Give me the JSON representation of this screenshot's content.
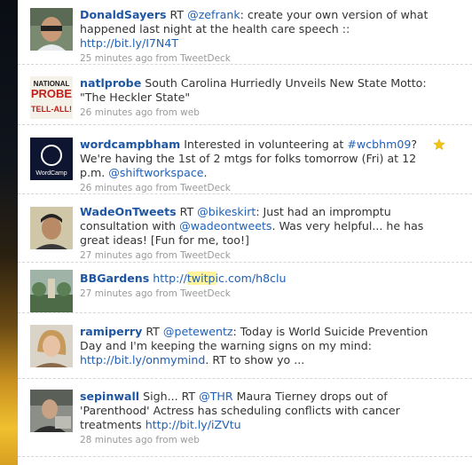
{
  "colors": {
    "author": "#1f56a3",
    "link": "#2061b8",
    "meta": "#9a9a9a",
    "highlight": "#fff49c",
    "star": "#f1c40f"
  },
  "tweets": [
    {
      "author": "DonaldSayers",
      "text_before": " RT ",
      "mention": "@zefrank",
      "text_after": ": create your own version of what happened last night at the health care speech :: ",
      "link": "http://bit.ly/I7N4T",
      "time": "25 minutes ago",
      "via": "from TweetDeck",
      "avatar_icon": "person-avatar-icon"
    },
    {
      "author": "natlprobe",
      "text": " South Carolina Hurriedly Unveils New State Motto: \"The Heckler State\"",
      "time": "26 minutes ago",
      "via": "from web",
      "avatar_logo_top": "NATIONAL",
      "avatar_logo_mid": "PROBE",
      "avatar_logo_bot": "TELL-ALL!"
    },
    {
      "author": "wordcampbham",
      "text_before": " Interested in volunteering at ",
      "hashtag": "#wcbhm09",
      "text_mid": "? We're having the 1st of 2 mtgs for folks tomorrow (Fri) at 12 p.m. ",
      "mention": "@shiftworkspace",
      "text_after": ".",
      "time": "26 minutes ago",
      "via": "from TweetDeck",
      "avatar_logo": "WordCamp",
      "favorited": true
    },
    {
      "author": "WadeOnTweets",
      "text_before": " RT ",
      "mention": "@bikeskirt",
      "text_mid": ": Just had an impromptu consultation with ",
      "mention2": "@wadeontweets",
      "text_after": ". Was very helpful... he has great ideas! [Fun for me, too!]",
      "time": "27 minutes ago",
      "via": "from TweetDeck"
    },
    {
      "author": "BBGardens",
      "link_before": "http://",
      "link_hl": "twitp",
      "link_after": "ic.com/h8clu",
      "time": "27 minutes ago",
      "via": "from TweetDeck"
    },
    {
      "author": "ramiperry",
      "text_before": " RT ",
      "mention": "@petewentz",
      "text_mid": ": Today is World Suicide Prevention Day and I'm keeping the warning signs on my mind: ",
      "link": "http://bit.ly/onmymind",
      "text_after": ". RT to show yo ...",
      "time": "27 minutes ago",
      "via": "from TweetDeck"
    },
    {
      "author": "sepinwall",
      "text_before": " Sigh... RT ",
      "mention": "@THR",
      "text_mid": " Maura Tierney drops out of 'Parenthood' Actress has scheduling conflicts with cancer treatments ",
      "link": "http://bit.ly/iZVtu",
      "time": "28 minutes ago",
      "via": "from web"
    }
  ]
}
